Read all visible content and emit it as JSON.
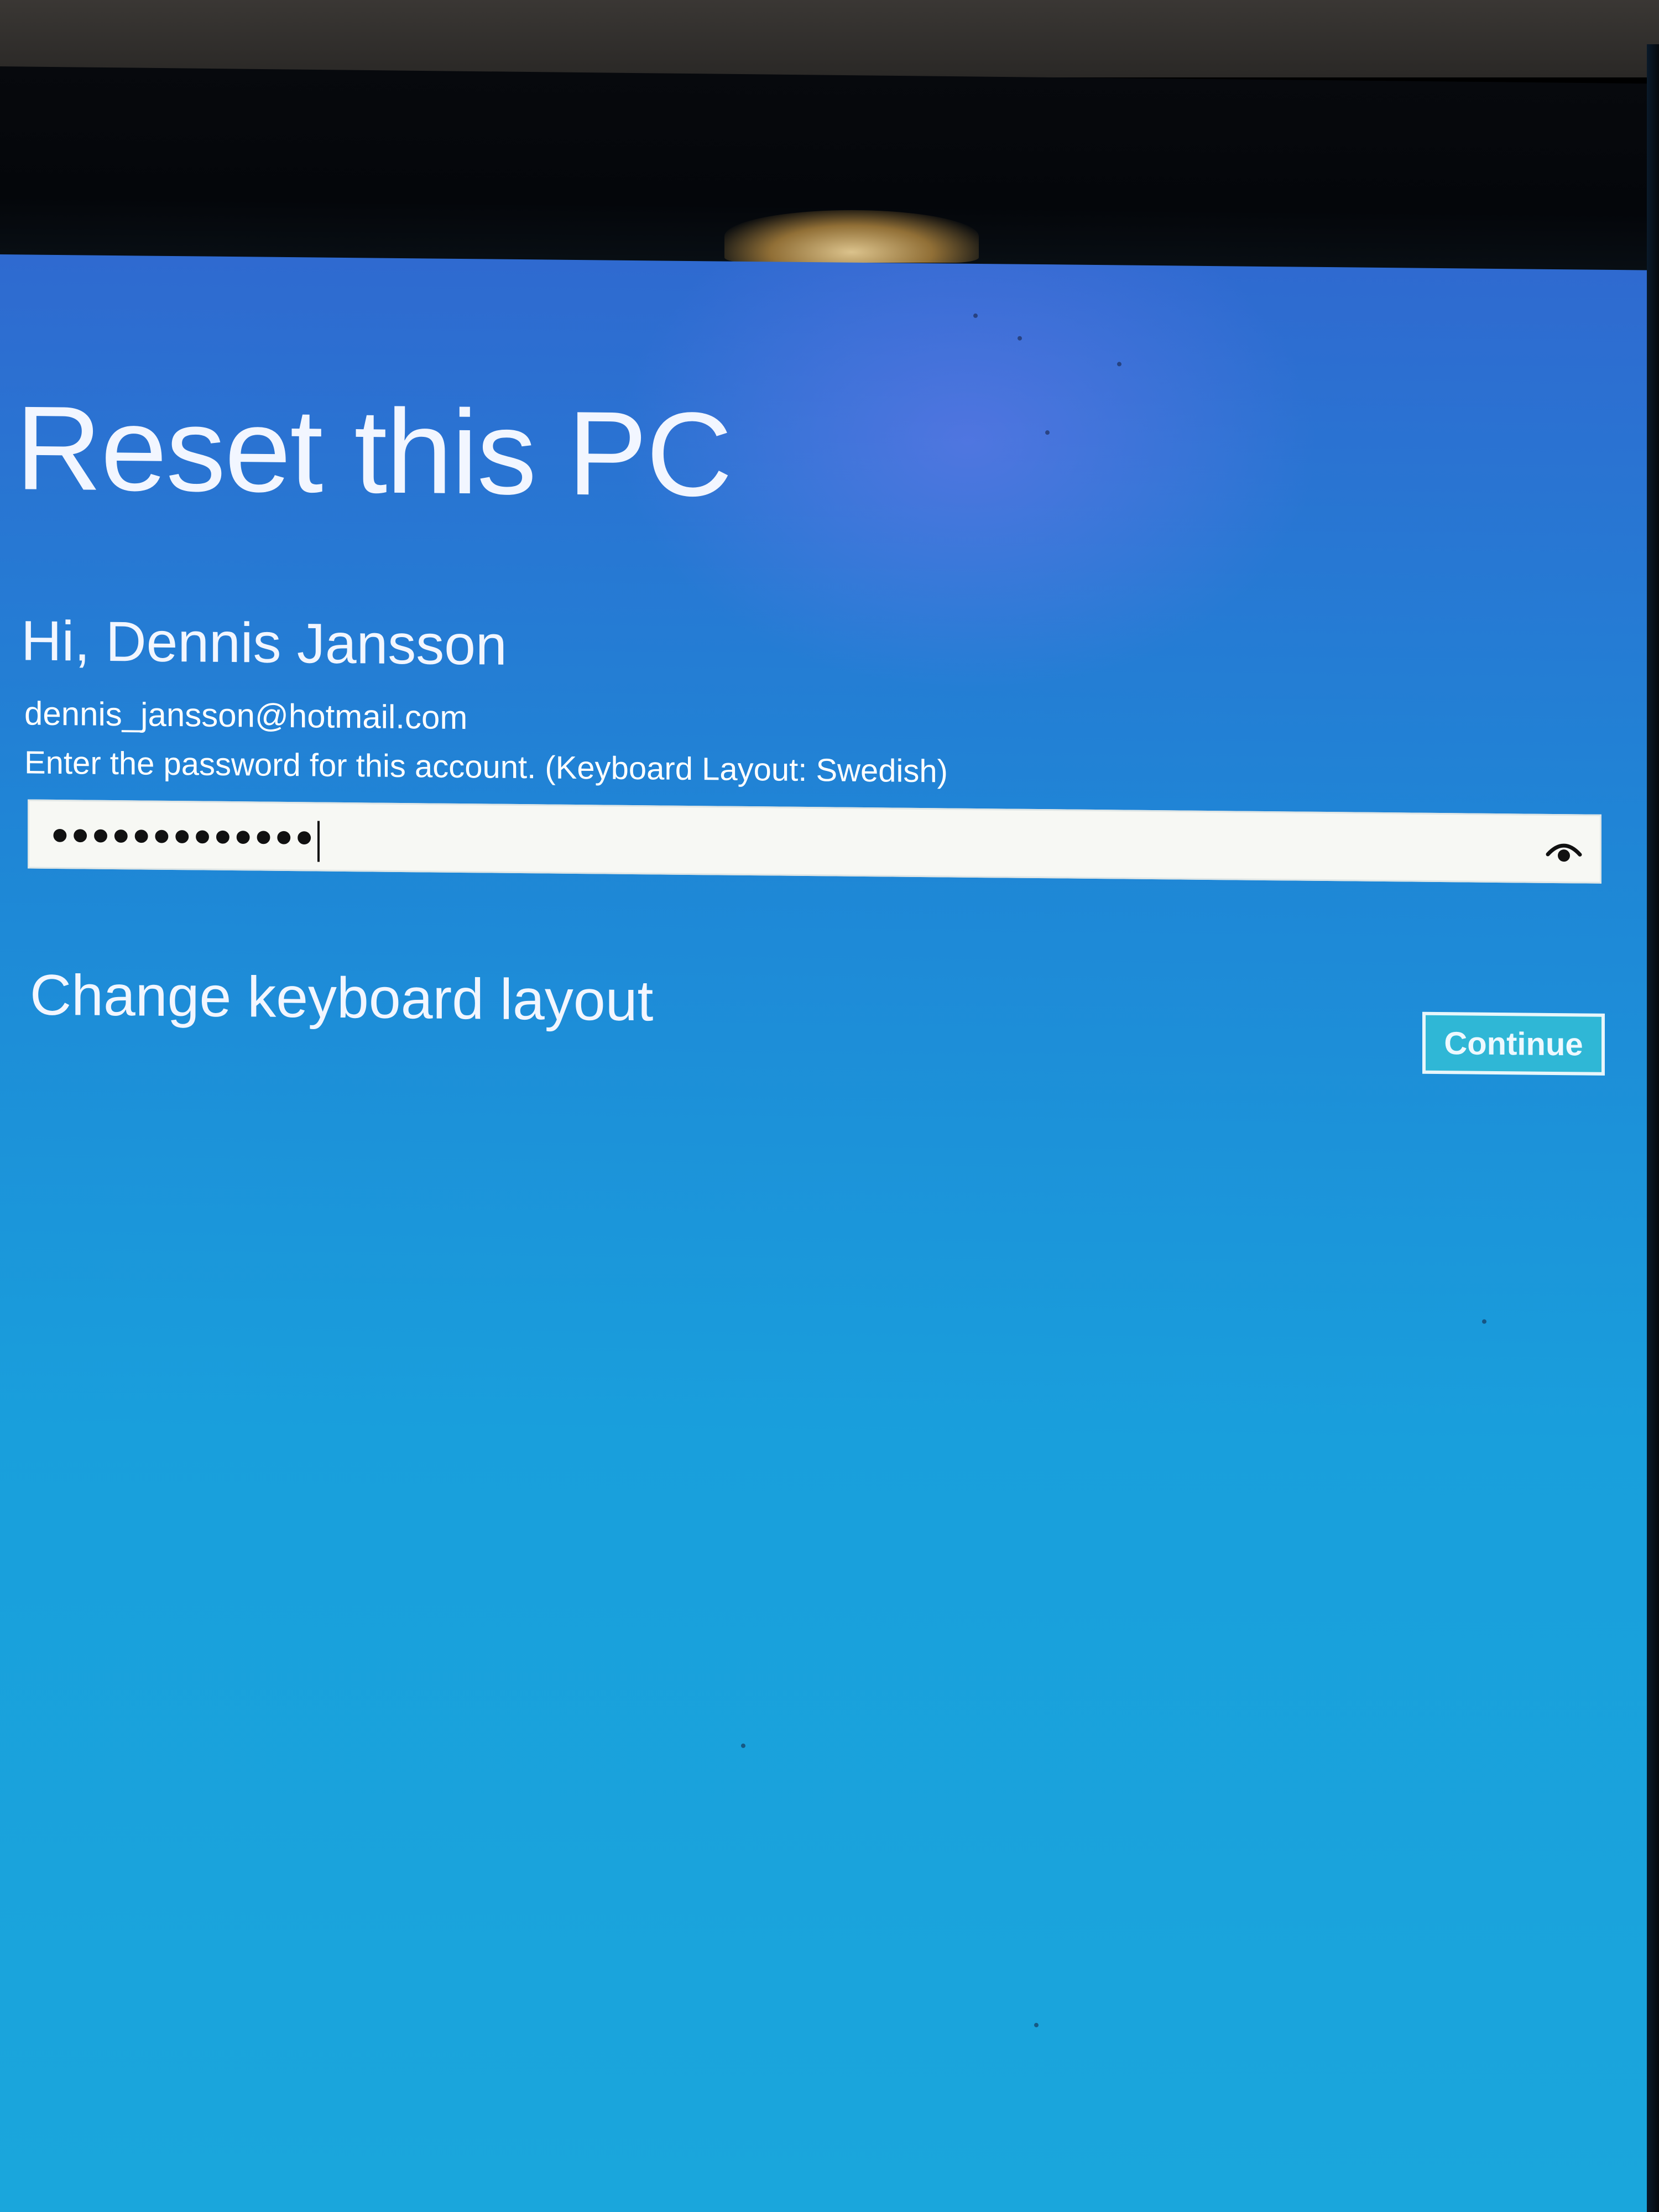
{
  "page": {
    "title": "Reset this PC"
  },
  "account": {
    "greeting": "Hi, Dennis Jansson",
    "email": "dennis_jansson@hotmail.com"
  },
  "password": {
    "instruction": "Enter the password for this account. (Keyboard Layout: Swedish)",
    "masked_value": "•••••••••••••",
    "reveal_icon": "eye-icon"
  },
  "links": {
    "change_keyboard_layout": "Change keyboard layout"
  },
  "buttons": {
    "continue_label": "Continue"
  },
  "colors": {
    "screen_top": "#2f6ad0",
    "screen_bottom": "#1aa6dc",
    "button_fill": "#2fb7d6",
    "text": "#ffffff"
  }
}
